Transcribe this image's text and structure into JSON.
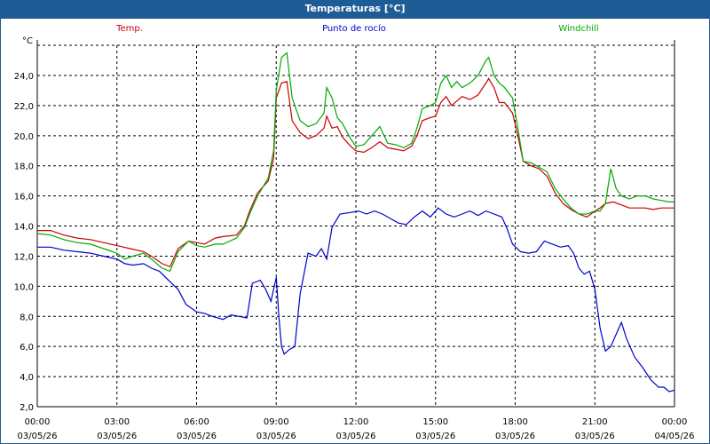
{
  "window": {
    "title": "Temperaturas [°C]"
  },
  "chart_data": {
    "type": "line",
    "title": "Temperaturas [°C]",
    "ylabel": "°C",
    "xlabel": "",
    "ylim": [
      2.0,
      25.0
    ],
    "xlim": [
      0,
      24
    ],
    "grid": true,
    "legend_position": "top",
    "y_ticks": [
      "2,0",
      "4,0",
      "6,0",
      "8,0",
      "10,0",
      "12,0",
      "14,0",
      "16,0",
      "18,0",
      "20,0",
      "22,0",
      "24,0"
    ],
    "x_ticks": [
      {
        "time": "00:00",
        "date": "03/05/26"
      },
      {
        "time": "03:00",
        "date": "03/05/26"
      },
      {
        "time": "06:00",
        "date": "03/05/26"
      },
      {
        "time": "09:00",
        "date": "03/05/26"
      },
      {
        "time": "12:00",
        "date": "03/05/26"
      },
      {
        "time": "15:00",
        "date": "03/05/26"
      },
      {
        "time": "18:00",
        "date": "03/05/26"
      },
      {
        "time": "21:00",
        "date": "03/05/26"
      },
      {
        "time": "00:00",
        "date": "04/05/26"
      }
    ],
    "series": [
      {
        "name": "Temp.",
        "color": "#cc0000",
        "legend_align": "left",
        "points": [
          [
            0,
            13.7
          ],
          [
            0.5,
            13.7
          ],
          [
            1,
            13.4
          ],
          [
            1.5,
            13.2
          ],
          [
            2,
            13.1
          ],
          [
            2.5,
            12.9
          ],
          [
            3,
            12.7
          ],
          [
            3.5,
            12.5
          ],
          [
            4,
            12.3
          ],
          [
            4.3,
            12.0
          ],
          [
            4.7,
            11.5
          ],
          [
            5,
            11.3
          ],
          [
            5.3,
            12.5
          ],
          [
            5.7,
            13.0
          ],
          [
            6,
            12.9
          ],
          [
            6.3,
            12.8
          ],
          [
            6.7,
            13.2
          ],
          [
            7,
            13.3
          ],
          [
            7.5,
            13.4
          ],
          [
            7.8,
            14.0
          ],
          [
            8,
            15.0
          ],
          [
            8.3,
            16.2
          ],
          [
            8.7,
            17.0
          ],
          [
            8.9,
            18.5
          ],
          [
            9.0,
            22.5
          ],
          [
            9.2,
            23.5
          ],
          [
            9.4,
            23.6
          ],
          [
            9.6,
            21.0
          ],
          [
            9.9,
            20.2
          ],
          [
            10.2,
            19.8
          ],
          [
            10.5,
            20.0
          ],
          [
            10.8,
            20.5
          ],
          [
            10.9,
            21.3
          ],
          [
            11.1,
            20.5
          ],
          [
            11.3,
            20.6
          ],
          [
            11.5,
            19.9
          ],
          [
            11.8,
            19.3
          ],
          [
            12,
            19.0
          ],
          [
            12.3,
            18.9
          ],
          [
            12.6,
            19.2
          ],
          [
            12.9,
            19.6
          ],
          [
            13.2,
            19.2
          ],
          [
            13.5,
            19.1
          ],
          [
            13.8,
            19.0
          ],
          [
            14.1,
            19.3
          ],
          [
            14.3,
            20.0
          ],
          [
            14.5,
            21.0
          ],
          [
            14.8,
            21.2
          ],
          [
            15,
            21.3
          ],
          [
            15.2,
            22.2
          ],
          [
            15.4,
            22.6
          ],
          [
            15.6,
            22.0
          ],
          [
            15.8,
            22.3
          ],
          [
            16.0,
            22.6
          ],
          [
            16.3,
            22.4
          ],
          [
            16.6,
            22.7
          ],
          [
            16.9,
            23.5
          ],
          [
            17.0,
            23.8
          ],
          [
            17.2,
            23.2
          ],
          [
            17.4,
            22.2
          ],
          [
            17.6,
            22.2
          ],
          [
            17.9,
            21.5
          ],
          [
            18.1,
            20.0
          ],
          [
            18.3,
            18.3
          ],
          [
            18.6,
            18.0
          ],
          [
            18.9,
            17.8
          ],
          [
            19.2,
            17.3
          ],
          [
            19.5,
            16.2
          ],
          [
            19.8,
            15.5
          ],
          [
            20.1,
            15.1
          ],
          [
            20.4,
            14.8
          ],
          [
            20.7,
            14.6
          ],
          [
            21.0,
            15.0
          ],
          [
            21.2,
            15.2
          ],
          [
            21.4,
            15.5
          ],
          [
            21.7,
            15.6
          ],
          [
            22.0,
            15.4
          ],
          [
            22.3,
            15.2
          ],
          [
            22.6,
            15.2
          ],
          [
            22.9,
            15.2
          ],
          [
            23.2,
            15.1
          ],
          [
            23.5,
            15.2
          ],
          [
            23.8,
            15.2
          ],
          [
            24,
            15.2
          ]
        ]
      },
      {
        "name": "Punto de rocío",
        "color": "#0000cc",
        "legend_align": "center",
        "points": [
          [
            0,
            12.6
          ],
          [
            0.5,
            12.6
          ],
          [
            1,
            12.4
          ],
          [
            1.5,
            12.3
          ],
          [
            2,
            12.2
          ],
          [
            2.5,
            12.0
          ],
          [
            3,
            11.8
          ],
          [
            3.3,
            11.5
          ],
          [
            3.6,
            11.4
          ],
          [
            4,
            11.5
          ],
          [
            4.3,
            11.2
          ],
          [
            4.6,
            11.0
          ],
          [
            5,
            10.3
          ],
          [
            5.3,
            9.8
          ],
          [
            5.6,
            8.8
          ],
          [
            6,
            8.3
          ],
          [
            6.3,
            8.2
          ],
          [
            6.6,
            8.0
          ],
          [
            7,
            7.8
          ],
          [
            7.3,
            8.1
          ],
          [
            7.6,
            8.0
          ],
          [
            7.9,
            7.9
          ],
          [
            8.1,
            10.2
          ],
          [
            8.4,
            10.4
          ],
          [
            8.6,
            9.8
          ],
          [
            8.8,
            9.0
          ],
          [
            9.0,
            10.6
          ],
          [
            9.1,
            8.0
          ],
          [
            9.2,
            6.0
          ],
          [
            9.3,
            5.5
          ],
          [
            9.5,
            5.8
          ],
          [
            9.7,
            6.0
          ],
          [
            9.9,
            9.5
          ],
          [
            10.2,
            12.2
          ],
          [
            10.5,
            12.0
          ],
          [
            10.7,
            12.5
          ],
          [
            10.9,
            11.8
          ],
          [
            11.1,
            13.9
          ],
          [
            11.4,
            14.8
          ],
          [
            11.8,
            14.9
          ],
          [
            12.1,
            15.0
          ],
          [
            12.4,
            14.8
          ],
          [
            12.7,
            15.0
          ],
          [
            13.0,
            14.8
          ],
          [
            13.3,
            14.5
          ],
          [
            13.6,
            14.2
          ],
          [
            13.9,
            14.1
          ],
          [
            14.2,
            14.6
          ],
          [
            14.5,
            15.0
          ],
          [
            14.8,
            14.6
          ],
          [
            15.1,
            15.2
          ],
          [
            15.4,
            14.8
          ],
          [
            15.7,
            14.6
          ],
          [
            16.0,
            14.8
          ],
          [
            16.3,
            15.0
          ],
          [
            16.6,
            14.7
          ],
          [
            16.9,
            15.0
          ],
          [
            17.2,
            14.8
          ],
          [
            17.5,
            14.6
          ],
          [
            17.7,
            13.8
          ],
          [
            17.9,
            12.8
          ],
          [
            18.2,
            12.3
          ],
          [
            18.5,
            12.2
          ],
          [
            18.8,
            12.3
          ],
          [
            19.1,
            13.0
          ],
          [
            19.4,
            12.8
          ],
          [
            19.7,
            12.6
          ],
          [
            20.0,
            12.7
          ],
          [
            20.2,
            12.2
          ],
          [
            20.4,
            11.2
          ],
          [
            20.6,
            10.8
          ],
          [
            20.8,
            11.0
          ],
          [
            21.0,
            9.8
          ],
          [
            21.2,
            7.2
          ],
          [
            21.4,
            5.7
          ],
          [
            21.6,
            6.0
          ],
          [
            21.8,
            6.8
          ],
          [
            22.0,
            7.6
          ],
          [
            22.2,
            6.5
          ],
          [
            22.5,
            5.3
          ],
          [
            22.8,
            4.6
          ],
          [
            23.1,
            3.8
          ],
          [
            23.4,
            3.3
          ],
          [
            23.6,
            3.3
          ],
          [
            23.8,
            3.0
          ],
          [
            24,
            3.1
          ]
        ]
      },
      {
        "name": "Windchill",
        "color": "#00aa00",
        "legend_align": "right",
        "points": [
          [
            0,
            13.5
          ],
          [
            0.5,
            13.4
          ],
          [
            1,
            13.1
          ],
          [
            1.5,
            12.9
          ],
          [
            2,
            12.8
          ],
          [
            2.5,
            12.5
          ],
          [
            3,
            12.2
          ],
          [
            3.3,
            11.8
          ],
          [
            3.6,
            12.0
          ],
          [
            4,
            12.2
          ],
          [
            4.3,
            11.8
          ],
          [
            4.7,
            11.2
          ],
          [
            5,
            11.0
          ],
          [
            5.3,
            12.3
          ],
          [
            5.7,
            13.0
          ],
          [
            6,
            12.7
          ],
          [
            6.3,
            12.6
          ],
          [
            6.7,
            12.8
          ],
          [
            7,
            12.8
          ],
          [
            7.5,
            13.2
          ],
          [
            7.8,
            13.9
          ],
          [
            8,
            14.8
          ],
          [
            8.3,
            16.0
          ],
          [
            8.7,
            17.2
          ],
          [
            8.9,
            19.0
          ],
          [
            9.0,
            23.0
          ],
          [
            9.2,
            25.2
          ],
          [
            9.4,
            25.5
          ],
          [
            9.6,
            22.5
          ],
          [
            9.9,
            21.0
          ],
          [
            10.2,
            20.6
          ],
          [
            10.5,
            20.8
          ],
          [
            10.8,
            21.5
          ],
          [
            10.9,
            23.2
          ],
          [
            11.1,
            22.5
          ],
          [
            11.3,
            21.2
          ],
          [
            11.5,
            20.8
          ],
          [
            11.8,
            19.8
          ],
          [
            12,
            19.3
          ],
          [
            12.3,
            19.4
          ],
          [
            12.6,
            20.0
          ],
          [
            12.9,
            20.6
          ],
          [
            13.2,
            19.5
          ],
          [
            13.5,
            19.4
          ],
          [
            13.8,
            19.2
          ],
          [
            14.1,
            19.5
          ],
          [
            14.3,
            20.5
          ],
          [
            14.5,
            21.8
          ],
          [
            14.8,
            22.0
          ],
          [
            15,
            22.2
          ],
          [
            15.2,
            23.5
          ],
          [
            15.4,
            24.0
          ],
          [
            15.6,
            23.2
          ],
          [
            15.8,
            23.6
          ],
          [
            16.0,
            23.2
          ],
          [
            16.3,
            23.5
          ],
          [
            16.6,
            24.0
          ],
          [
            16.9,
            25.0
          ],
          [
            17.0,
            25.2
          ],
          [
            17.2,
            24.0
          ],
          [
            17.4,
            23.5
          ],
          [
            17.6,
            23.2
          ],
          [
            17.9,
            22.5
          ],
          [
            18.1,
            20.5
          ],
          [
            18.3,
            18.3
          ],
          [
            18.6,
            18.2
          ],
          [
            18.9,
            17.9
          ],
          [
            19.2,
            17.6
          ],
          [
            19.5,
            16.5
          ],
          [
            19.8,
            15.8
          ],
          [
            20.1,
            15.2
          ],
          [
            20.4,
            14.8
          ],
          [
            20.7,
            14.8
          ],
          [
            21.0,
            15.0
          ],
          [
            21.2,
            15.0
          ],
          [
            21.4,
            15.5
          ],
          [
            21.6,
            17.8
          ],
          [
            21.8,
            16.5
          ],
          [
            22.0,
            16.0
          ],
          [
            22.3,
            15.8
          ],
          [
            22.6,
            16.0
          ],
          [
            22.9,
            16.0
          ],
          [
            23.2,
            15.8
          ],
          [
            23.5,
            15.7
          ],
          [
            23.8,
            15.6
          ],
          [
            24,
            15.6
          ]
        ]
      }
    ]
  }
}
